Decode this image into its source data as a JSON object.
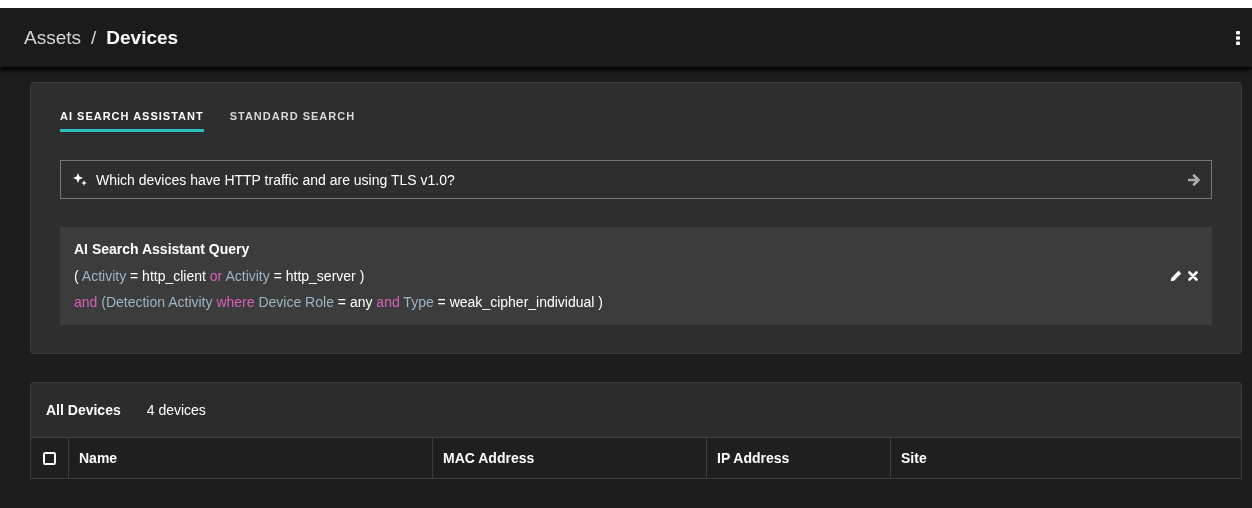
{
  "breadcrumb_separator": "/",
  "breadcrumb": [
    {
      "label": "Assets",
      "current": false
    },
    {
      "label": "Devices",
      "current": true
    }
  ],
  "tabs": [
    {
      "label": "AI SEARCH ASSISTANT",
      "selected": true
    },
    {
      "label": "STANDARD SEARCH",
      "selected": false
    }
  ],
  "search": {
    "value": "Which devices have HTTP traffic and are using TLS v1.0?"
  },
  "query": {
    "title": "AI Search Assistant Query",
    "lines": [
      [
        {
          "text": "(",
          "kind": "punct"
        },
        {
          "text": "Activity",
          "kind": "field"
        },
        {
          "text": "=",
          "kind": "punct"
        },
        {
          "text": "http_client",
          "kind": "value"
        },
        {
          "text": "or",
          "kind": "op"
        },
        {
          "text": "Activity",
          "kind": "field"
        },
        {
          "text": "=",
          "kind": "punct"
        },
        {
          "text": "http_server",
          "kind": "value"
        },
        {
          "text": ")",
          "kind": "punct"
        }
      ],
      [
        {
          "text": "and",
          "kind": "op"
        },
        {
          "text": "(Detection Activity",
          "kind": "field"
        },
        {
          "text": "where",
          "kind": "op"
        },
        {
          "text": "Device Role",
          "kind": "field"
        },
        {
          "text": "=",
          "kind": "punct"
        },
        {
          "text": "any",
          "kind": "value"
        },
        {
          "text": "and",
          "kind": "op"
        },
        {
          "text": "Type",
          "kind": "field"
        },
        {
          "text": "=",
          "kind": "punct"
        },
        {
          "text": "weak_cipher_individual",
          "kind": "value"
        },
        {
          "text": ")",
          "kind": "punct"
        }
      ]
    ]
  },
  "table": {
    "title": "All Devices",
    "count": "4 devices",
    "select_all": {
      "checked": false
    },
    "columns": [
      "Name",
      "MAC Address",
      "IP Address",
      "Site"
    ]
  }
}
